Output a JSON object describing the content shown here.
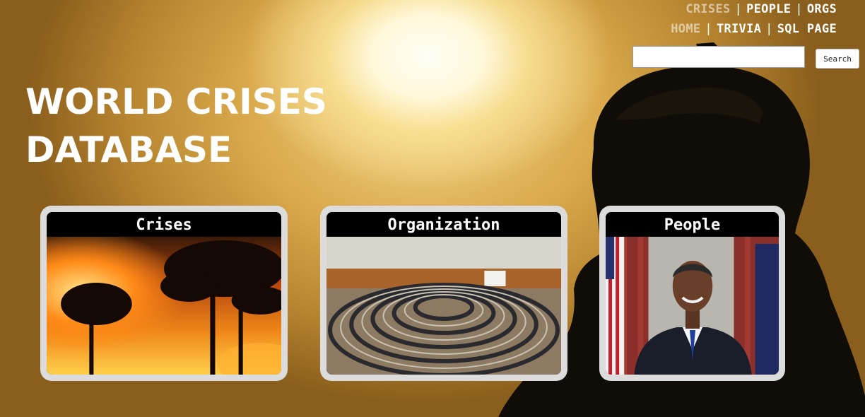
{
  "nav": {
    "row1": [
      "CRISES",
      "PEOPLE",
      "ORGS"
    ],
    "row2": [
      "HOME",
      "TRIVIA",
      "SQL PAGE"
    ],
    "separator": "|"
  },
  "search": {
    "value": "",
    "placeholder": "",
    "button_label": "Search"
  },
  "title": {
    "line1": "WORLD CRISES",
    "line2": "DATABASE"
  },
  "cards": [
    {
      "label": "Crises",
      "image": "forest-fire-image"
    },
    {
      "label": "Organization",
      "image": "assembly-hall-image"
    },
    {
      "label": "People",
      "image": "portrait-image"
    }
  ],
  "colors": {
    "accent": "#ffffff",
    "card_frame": "#dcdcdc",
    "card_header": "#000000"
  }
}
